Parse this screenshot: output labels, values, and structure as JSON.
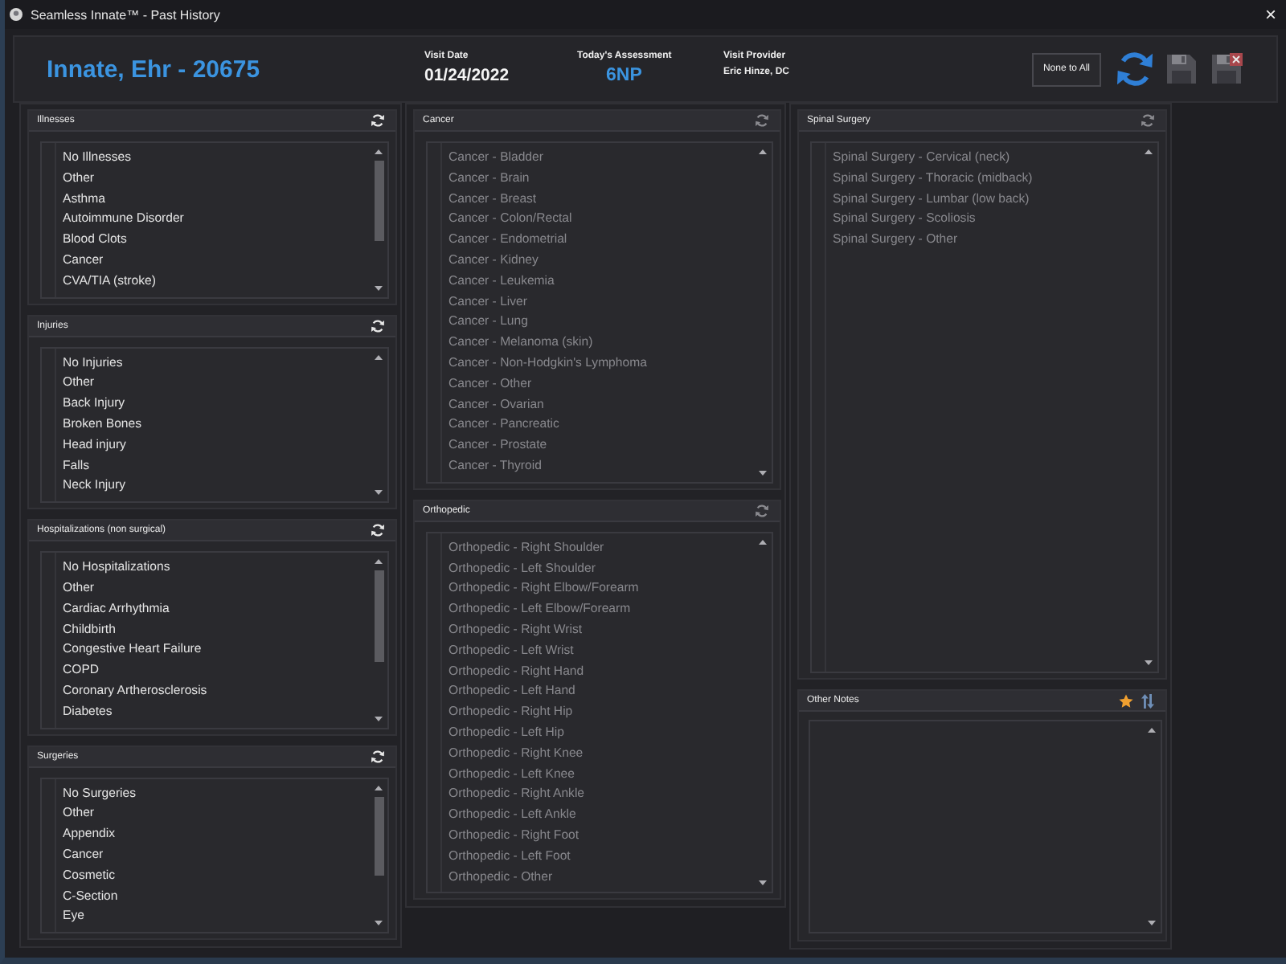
{
  "window": {
    "title": "Seamless Innate™ - Past History",
    "close": "×"
  },
  "header": {
    "patient": "Innate, Ehr - 20675",
    "fields": [
      {
        "kind": "date",
        "label": "Visit Date",
        "value": "01/24/2022"
      },
      {
        "kind": "assessment",
        "label": "Today's Assessment",
        "value": "6NP"
      },
      {
        "kind": "provider",
        "label": "Visit Provider",
        "value": "Eric Hinze, DC"
      }
    ],
    "buttons": [
      {
        "kind": "text",
        "label": "None to All",
        "disabled": false
      },
      {
        "kind": "refresh",
        "disabled": false
      },
      {
        "kind": "save",
        "disabled": true
      },
      {
        "kind": "save-close",
        "disabled": true
      }
    ]
  },
  "columns": [
    {
      "panels": [
        {
          "kind": "list",
          "title": "Illnesses",
          "disabled": false,
          "scrollable": true,
          "items": [
            "No Illnesses",
            "Other",
            "Asthma",
            "Autoimmune Disorder",
            "Blood Clots",
            "Cancer",
            "CVA/TIA (stroke)"
          ]
        },
        {
          "kind": "list",
          "title": "Injuries",
          "disabled": false,
          "scrollable": false,
          "items": [
            "No Injuries",
            "Other",
            "Back Injury",
            "Broken Bones",
            "Head injury",
            "Falls",
            "Neck Injury"
          ]
        },
        {
          "kind": "list",
          "title": "Hospitalizations (non surgical)",
          "disabled": false,
          "scrollable": true,
          "items": [
            "No Hospitalizations",
            "Other",
            "Cardiac Arrhythmia",
            "Childbirth",
            "Congestive Heart Failure",
            "COPD",
            "Coronary Artherosclerosis",
            "Diabetes"
          ]
        },
        {
          "kind": "list",
          "title": "Surgeries",
          "disabled": false,
          "scrollable": true,
          "items": [
            "No Surgeries",
            "Other",
            "Appendix",
            "Cancer",
            "Cosmetic",
            "C-Section",
            "Eye"
          ]
        }
      ]
    },
    {
      "panels": [
        {
          "kind": "list",
          "title": "Cancer",
          "disabled": true,
          "scrollable": false,
          "items": [
            "Cancer - Bladder",
            "Cancer - Brain",
            "Cancer - Breast",
            "Cancer - Colon/Rectal",
            "Cancer - Endometrial",
            "Cancer - Kidney",
            "Cancer - Leukemia",
            "Cancer - Liver",
            "Cancer - Lung",
            "Cancer - Melanoma (skin)",
            "Cancer - Non-Hodgkin's Lymphoma",
            "Cancer - Other",
            "Cancer - Ovarian",
            "Cancer - Pancreatic",
            "Cancer - Prostate",
            "Cancer - Thyroid"
          ]
        },
        {
          "kind": "list",
          "title": "Orthopedic",
          "disabled": true,
          "scrollable": false,
          "items": [
            "Orthopedic - Right Shoulder",
            "Orthopedic - Left Shoulder",
            "Orthopedic - Right Elbow/Forearm",
            "Orthopedic - Left Elbow/Forearm",
            "Orthopedic - Right Wrist",
            "Orthopedic - Left Wrist",
            "Orthopedic - Right Hand",
            "Orthopedic - Left Hand",
            "Orthopedic - Right Hip",
            "Orthopedic - Left Hip",
            "Orthopedic - Right Knee",
            "Orthopedic - Left Knee",
            "Orthopedic - Right Ankle",
            "Orthopedic - Left Ankle",
            "Orthopedic - Right Foot",
            "Orthopedic - Left Foot",
            "Orthopedic - Other"
          ]
        }
      ]
    },
    {
      "panels": [
        {
          "kind": "list",
          "title": "Spinal Surgery",
          "disabled": true,
          "scrollable": false,
          "items": [
            "Spinal Surgery - Cervical (neck)",
            "Spinal Surgery - Thoracic (midback)",
            "Spinal Surgery - Lumbar (low back)",
            "Spinal Surgery - Scoliosis",
            "Spinal Surgery - Other"
          ]
        },
        {
          "kind": "notes",
          "title": "Other Notes"
        }
      ]
    }
  ]
}
